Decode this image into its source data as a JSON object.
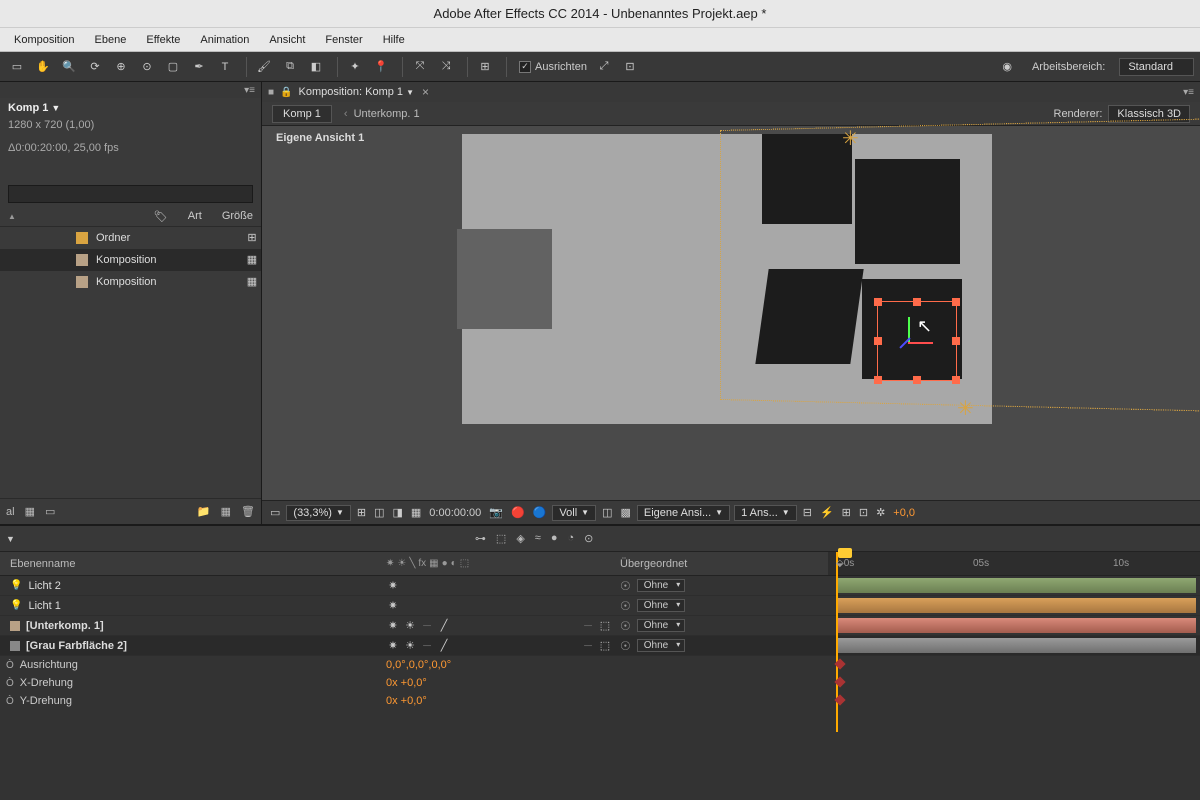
{
  "title": "Adobe After Effects CC 2014 - Unbenanntes Projekt.aep *",
  "menu": [
    "Komposition",
    "Ebene",
    "Effekte",
    "Animation",
    "Ansicht",
    "Fenster",
    "Hilfe"
  ],
  "toolbar": {
    "snapping_label": "Ausrichten",
    "workspace_label": "Arbeitsbereich:",
    "workspace_value": "Standard"
  },
  "project": {
    "comp_name": "Komp 1",
    "dims": "1280 x 720 (1,00)",
    "duration": "Δ0:00:20:00, 25,00 fps",
    "header_type": "Art",
    "header_size": "Größe",
    "items": [
      {
        "name": "Ordner",
        "kind": "folder",
        "swatch": "sw-orange"
      },
      {
        "name": "Komposition",
        "kind": "comp",
        "swatch": "sw-tan"
      },
      {
        "name": "Komposition",
        "kind": "comp",
        "swatch": "sw-tan"
      }
    ],
    "footer_left": "al"
  },
  "comp_panel": {
    "tab_label": "Komposition: Komp 1",
    "bc_active": "Komp 1",
    "bc_next": "Unterkomp. 1",
    "renderer_label": "Renderer:",
    "renderer_value": "Klassisch 3D",
    "view_label": "Eigene Ansicht 1"
  },
  "viewer": {
    "zoom": "(33,3%)",
    "time": "0:00:00:00",
    "resolution": "Voll",
    "camera": "Eigene Ansi...",
    "views": "1 Ans...",
    "exposure": "+0,0"
  },
  "timeline": {
    "col_name": "Ebenenname",
    "col_parent": "Übergeordnet",
    "ticks": {
      "t5": "05s",
      "t10": "10s"
    },
    "layers": [
      {
        "name": "Licht 2",
        "color": "lc-green",
        "light": true,
        "bar": "bar-green",
        "parent": "Ohne",
        "cube": false
      },
      {
        "name": "Licht 1",
        "color": "lc-green",
        "light": true,
        "bar": "bar-orange",
        "parent": "Ohne",
        "cube": false
      },
      {
        "name": "[Unterkomp. 1]",
        "color": "lc-tan",
        "light": false,
        "bold": true,
        "bar": "bar-red",
        "parent": "Ohne",
        "cube": true
      },
      {
        "name": "[Grau Farbfläche 2]",
        "color": "lc-grey",
        "light": false,
        "bold": true,
        "bar": "bar-grey",
        "parent": "Ohne",
        "cube": true,
        "selected": true
      }
    ],
    "props": [
      {
        "label": "Ausrichtung",
        "value": "0,0°,0,0°,0,0°"
      },
      {
        "label": "X-Drehung",
        "value": "0x +0,0°"
      },
      {
        "label": "Y-Drehung",
        "value": "0x +0,0°"
      }
    ]
  }
}
